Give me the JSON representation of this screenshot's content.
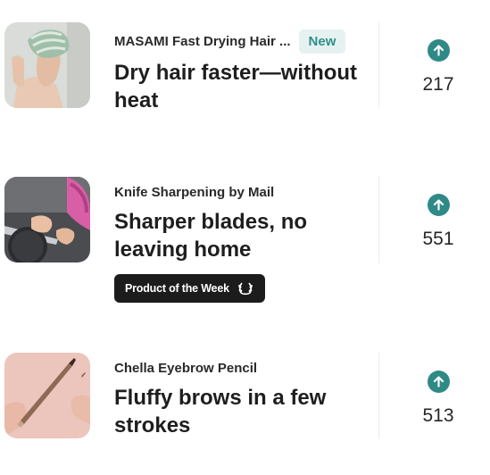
{
  "products": [
    {
      "name": "MASAMI Fast Drying Hair ...",
      "badge": "New",
      "headline": "Dry hair faster—without heat",
      "votes": "217",
      "thumb_icon": "hair-towel-photo"
    },
    {
      "name": "Knife Sharpening by Mail",
      "headline": "Sharper blades, no leaving home",
      "award": "Product of the Week",
      "award_icon": "laurel-icon",
      "votes": "551",
      "thumb_icon": "knife-sharpening-photo"
    },
    {
      "name": "Chella Eyebrow Pencil",
      "headline": "Fluffy brows in a few strokes",
      "votes": "513",
      "thumb_icon": "eyebrow-pencil-photo"
    }
  ],
  "colors": {
    "accent": "#2f8a87",
    "badge_bg": "#e6f2f1",
    "award_bg": "#1c1c1c"
  }
}
